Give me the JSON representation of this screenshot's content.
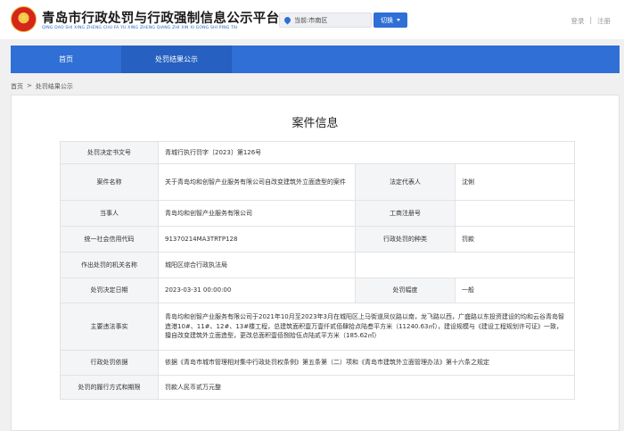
{
  "header": {
    "title": "青岛市行政处罚与行政强制信息公示平台",
    "subtitle": "QING DAO SHI XING ZHENG CHU FA YU XING ZHENG QIANG ZHI XIN XI GONG SHI PING TAI",
    "location": "当前:市南区",
    "switch_label": "切换",
    "login": "登录",
    "divider": "|",
    "register": "注册"
  },
  "nav": {
    "items": [
      "首页",
      "处罚结果公示"
    ],
    "active": 1
  },
  "breadcrumb": {
    "home": "首页",
    "sep": ">",
    "current": "处罚结果公示"
  },
  "case": {
    "title": "案件信息",
    "decision_no_label": "处罚决定书文号",
    "decision_no": "青城行执行罚字〔2023〕第126号",
    "case_name_label": "案件名称",
    "case_name": "关于青岛均和创智产业服务有限公司自改变建筑外立面造型的案件",
    "legal_rep_label": "法定代表人",
    "legal_rep": "沈俐",
    "party_label": "当事人",
    "party": "青岛均和创智产业服务有限公司",
    "biz_reg_label": "工商注册号",
    "biz_reg": "",
    "credit_code_label": "统一社会信用代码",
    "credit_code": "91370214MA3TRTP128",
    "penalty_type_label": "行政处罚的种类",
    "penalty_type": "罚款",
    "authority_label": "作出处罚的机关名称",
    "authority": "城阳区综合行政执法局",
    "date_label": "处罚决定日期",
    "date": "2023-03-31 00:00:00",
    "range_label": "处罚幅度",
    "range": "一般",
    "facts_label": "主要违法事实",
    "facts": "青岛均和创智产业服务有限公司于2021年10月至2023年3月在城阳区上马街道凤仪路以南，龙飞路以西，广盛路以东投资建设的均和云谷青岛智造港10#、11#、12#、13#楼工程，总建筑面积壹万壹仟贰佰肆拾点陆叁平方米（11240.63㎡），建设规模与《建设工程规划许可证》一致，擅自改变建筑外立面造型，更改总面积壹佰捌拾伍点陆贰平方米（185.62㎡）",
    "basis_label": "行政处罚依据",
    "basis": "依据《青岛市城市管理相对集中行政处罚权条例》第五条第（二）项和《青岛市建筑外立面管理办法》第十六条之规定",
    "performance_label": "处罚的履行方式和期限",
    "performance": "罚款人民币贰万元整"
  }
}
